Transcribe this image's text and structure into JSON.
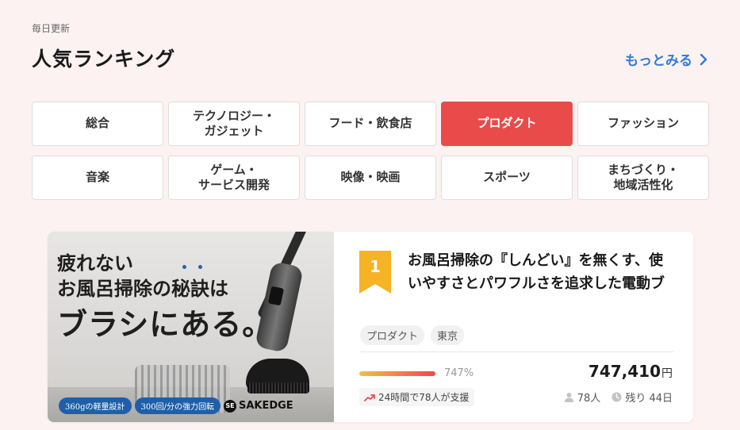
{
  "header": {
    "subtitle": "毎日更新",
    "title": "人気ランキング",
    "more_label": "もっとみる"
  },
  "categories": [
    {
      "label": "総合",
      "active": false
    },
    {
      "label": "テクノロジー・\nガジェット",
      "active": false
    },
    {
      "label": "フード・飲食店",
      "active": false
    },
    {
      "label": "プロダクト",
      "active": true
    },
    {
      "label": "ファッション",
      "active": false
    },
    {
      "label": "音楽",
      "active": false
    },
    {
      "label": "ゲーム・\nサービス開発",
      "active": false
    },
    {
      "label": "映像・映画",
      "active": false
    },
    {
      "label": "スポーツ",
      "active": false
    },
    {
      "label": "まちづくり・\n地域活性化",
      "active": false
    }
  ],
  "project": {
    "rank": "1",
    "title": "お風呂掃除の『しんどい』を無くす、使いやすさとパワフルさを追求した電動ブラシ",
    "tags": [
      "プロダクト",
      "東京"
    ],
    "progress_percent": 747,
    "progress_label": "747%",
    "amount": "747,410",
    "currency": "円",
    "trend_text": "24時間で78人が支援",
    "supporters": "78人",
    "remaining": "残り 44日",
    "promo": {
      "line1": "疲れない",
      "line2": "お風呂掃除の秘訣は",
      "line3": "ブラシにある。",
      "badge1": "360gの軽量設計",
      "badge2": "300回/分の強力回転",
      "brand": "SAKEDGE"
    }
  },
  "colors": {
    "background": "#fdf2f2",
    "accent": "#e94b4b",
    "link": "#2f7bd8",
    "rank_badge": "#f5b325"
  },
  "icons": {
    "more": "chevron-right-icon",
    "trend": "trend-up-icon",
    "supporters": "person-icon",
    "remaining": "clock-icon"
  }
}
